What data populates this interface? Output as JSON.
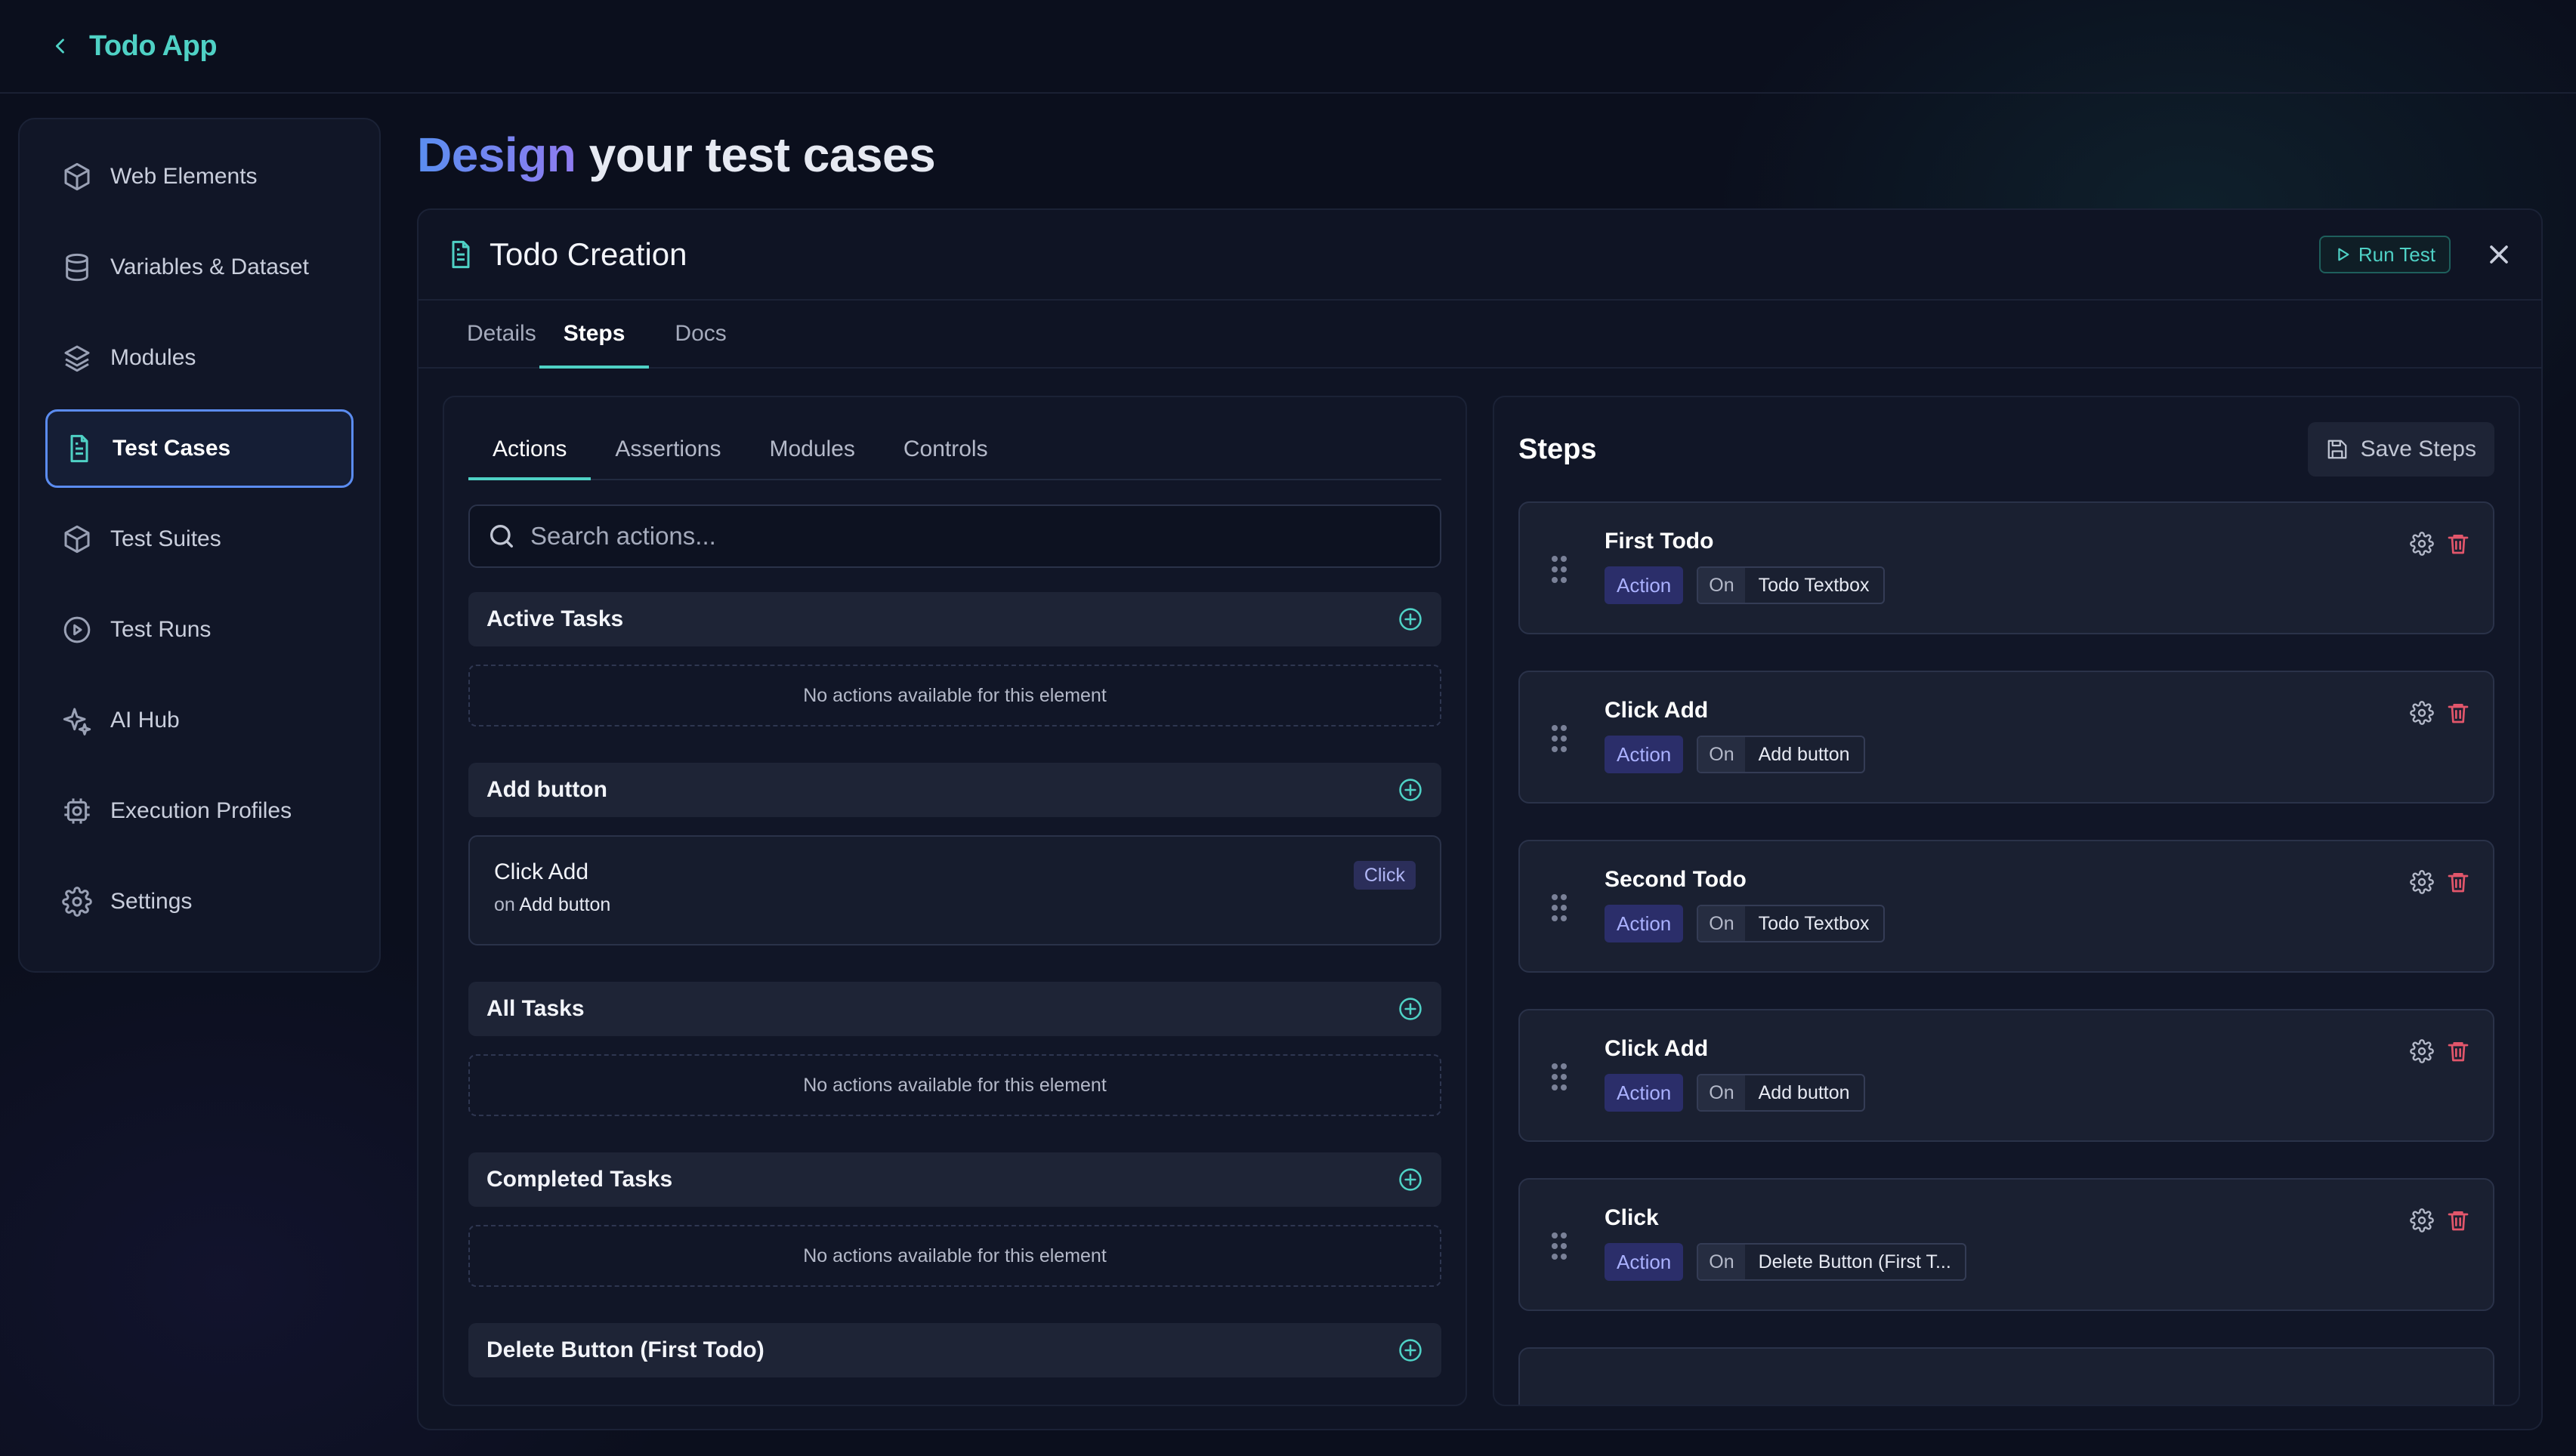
{
  "app": {
    "title": "Todo App"
  },
  "sidebar": {
    "items": [
      {
        "label": "Web Elements",
        "icon": "cube-icon"
      },
      {
        "label": "Variables & Dataset",
        "icon": "database-icon"
      },
      {
        "label": "Modules",
        "icon": "layers-icon"
      },
      {
        "label": "Test Cases",
        "icon": "document-icon",
        "active": true
      },
      {
        "label": "Test Suites",
        "icon": "cube-icon"
      },
      {
        "label": "Test Runs",
        "icon": "play-circle-icon"
      },
      {
        "label": "AI Hub",
        "icon": "sparkles-icon"
      },
      {
        "label": "Execution Profiles",
        "icon": "chip-icon"
      },
      {
        "label": "Settings",
        "icon": "gear-icon"
      }
    ]
  },
  "heading": {
    "accent": "Design",
    "rest": " your test cases"
  },
  "panel": {
    "title": "Todo Creation",
    "run_test_label": "Run Test",
    "tabs": [
      "Details",
      "Steps",
      "Docs"
    ],
    "active_tab": "Steps"
  },
  "library": {
    "sub_tabs": [
      "Actions",
      "Assertions",
      "Modules",
      "Controls"
    ],
    "active_sub_tab": "Actions",
    "search_placeholder": "Search actions...",
    "empty_text": "No actions available for this element",
    "groups": [
      {
        "name": "Active Tasks",
        "actions": []
      },
      {
        "name": "Add button",
        "actions": [
          {
            "name": "Click Add",
            "on_prefix": "on",
            "target": "Add button",
            "type": "Click"
          }
        ]
      },
      {
        "name": "All Tasks",
        "actions": []
      },
      {
        "name": "Completed Tasks",
        "actions": []
      },
      {
        "name": "Delete Button (First Todo)",
        "actions": []
      }
    ]
  },
  "steps": {
    "title": "Steps",
    "save_label": "Save Steps",
    "action_badge": "Action",
    "on_label": "On",
    "items": [
      {
        "name": "First Todo",
        "target": "Todo Textbox"
      },
      {
        "name": "Click Add",
        "target": "Add button"
      },
      {
        "name": "Second Todo",
        "target": "Todo Textbox"
      },
      {
        "name": "Click Add",
        "target": "Add button"
      },
      {
        "name": "Click",
        "target": "Delete Button (First T..."
      }
    ]
  },
  "colors": {
    "accent": "#4fd1c5",
    "active_border": "#5b8cf0",
    "danger": "#e2566b",
    "badge_bg": "#2b2e6a"
  }
}
